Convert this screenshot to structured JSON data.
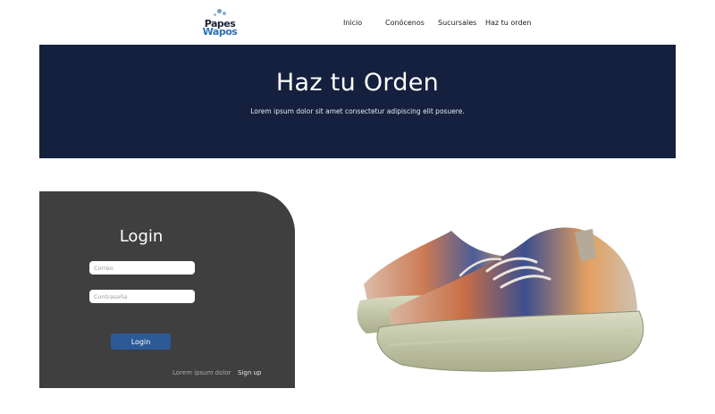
{
  "brand": {
    "logo_line1": "Papes",
    "logo_line2": "Wapos"
  },
  "nav": {
    "items": [
      {
        "label": "Inicio"
      },
      {
        "label": "Conócenos"
      },
      {
        "label": "Sucursales"
      },
      {
        "label": "Haz tu orden"
      }
    ]
  },
  "hero": {
    "title": "Haz tu Orden",
    "subtitle": "Lorem ipsum dolor sit amet consectetur adipiscing elit posuere."
  },
  "login": {
    "title": "Login",
    "email_placeholder": "Correo",
    "email_value": "",
    "password_placeholder": "Contraseña",
    "password_value": "",
    "button_label": "Login",
    "footer_text": "Lorem ipsum dolor",
    "signup_label": "Sign up"
  },
  "colors": {
    "hero_bg": "#14203d",
    "card_bg": "#3f3f3f",
    "button_bg": "#2b5a96",
    "logo_dark": "#1b2338",
    "logo_blue": "#2e6fb3"
  },
  "product": {
    "icon": "sneaker-image"
  }
}
